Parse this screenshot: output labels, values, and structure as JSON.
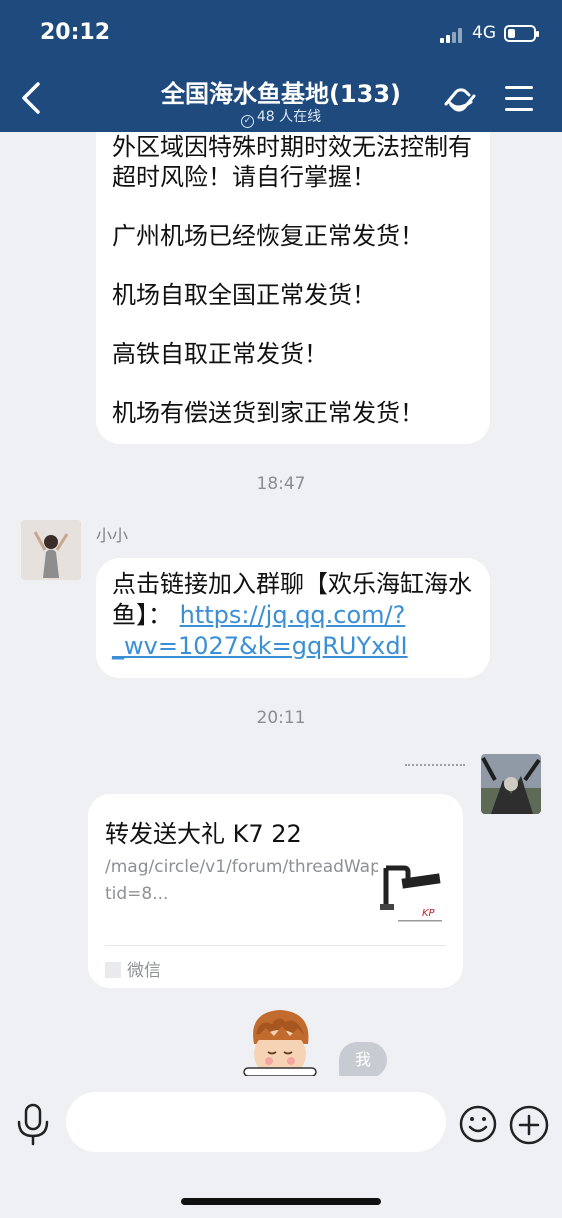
{
  "status_bar": {
    "time": "20:12",
    "network": "4G"
  },
  "header": {
    "title": "全国海水鱼基地(133)",
    "subtitle": "48 人在线"
  },
  "messages": {
    "announcement_lines": [
      "外区域因特殊时期时效无法控制有超时风险！请自行掌握！",
      "广州机场已经恢复正常发货！",
      "机场自取全国正常发货！",
      "高铁自取正常发货！",
      "机场有偿送货到家正常发货！"
    ],
    "time_1": "18:47",
    "sender_1": "小小",
    "link_message_text": "点击链接加入群聊【欢乐海缸海水鱼】：",
    "link_message_url": "https://jq.qq.com/?_wv=1027&k=gqRUYxdI",
    "time_2": "20:11",
    "card": {
      "title": "转发送大礼 K7 22",
      "description": "/mag/circle/v1/forum/threadWapPage?tid=8...",
      "source": "微信"
    },
    "me_badge": "我"
  },
  "input": {
    "placeholder": ""
  },
  "colors": {
    "header_bg": "#1e4a7d",
    "link": "#3b8fd4",
    "chat_bg": "#eef0f4"
  }
}
